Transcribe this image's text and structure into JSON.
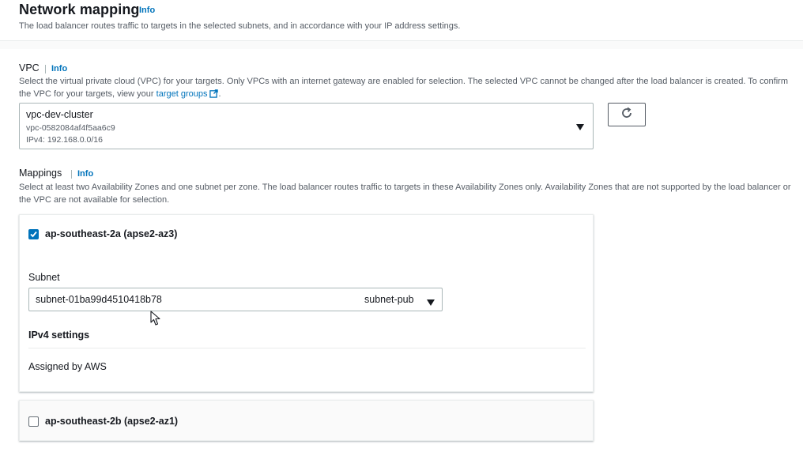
{
  "header": {
    "title": "Network mapping",
    "info": "Info",
    "description": "The load balancer routes traffic to targets in the selected subnets, and in accordance with your IP address settings."
  },
  "vpc": {
    "label": "VPC",
    "info": "Info",
    "description_before_link": "Select the virtual private cloud (VPC) for your targets. Only VPCs with an internet gateway are enabled for selection. The selected VPC cannot be changed after the load balancer is created. To confirm the VPC for your targets, view your ",
    "link_text": "target groups",
    "description_after_link": ".",
    "selected_name": "vpc-dev-cluster",
    "selected_id": "vpc-0582084af4f5aa6c9",
    "selected_cidr": "IPv4: 192.168.0.0/16"
  },
  "mappings": {
    "label": "Mappings",
    "info": "Info",
    "description": "Select at least two Availability Zones and one subnet per zone. The load balancer routes traffic to targets in these Availability Zones only. Availability Zones that are not supported by the load balancer or the VPC are not available for selection.",
    "zones": [
      {
        "name": "ap-southeast-2a (apse2-az3)",
        "checked": true,
        "subnet_label": "Subnet",
        "subnet_value": "subnet-01ba99d4510418b78",
        "subnet_name": "subnet-pub",
        "ipv4_title": "IPv4 settings",
        "ipv4_value": "Assigned by AWS"
      },
      {
        "name": "ap-southeast-2b (apse2-az1)",
        "checked": false
      }
    ]
  },
  "colors": {
    "accent": "#0073bb",
    "text": "#16191f",
    "muted": "#545b64",
    "border": "#aab7b8"
  }
}
